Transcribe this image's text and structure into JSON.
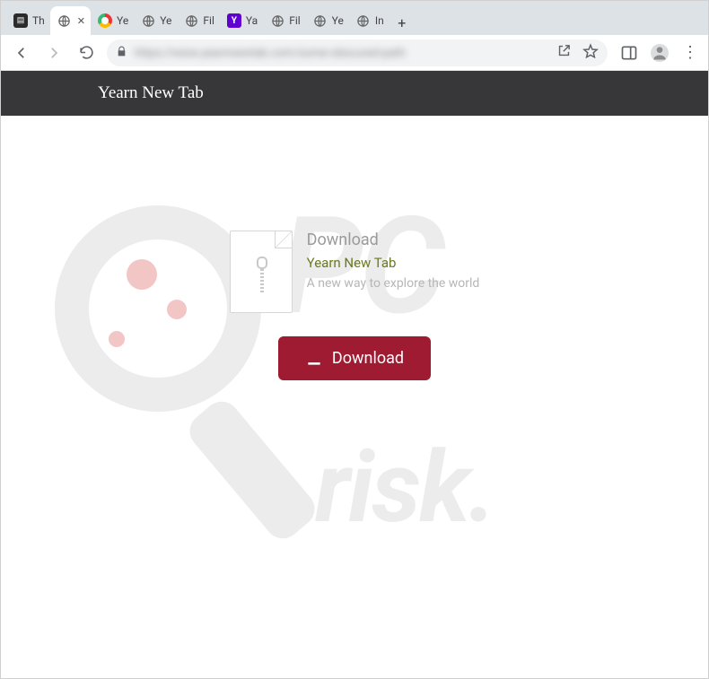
{
  "window": {
    "controls": {
      "min": "—",
      "max": "□",
      "close": "✕"
    }
  },
  "tabs": [
    {
      "label": "Th",
      "icon": "dark"
    },
    {
      "label": "",
      "icon": "globe",
      "loading": true
    },
    {
      "label": "Ye",
      "icon": "chrome"
    },
    {
      "label": "Ye",
      "icon": "globe"
    },
    {
      "label": "Fil",
      "icon": "globe"
    },
    {
      "label": "Ya",
      "icon": "yahoo"
    },
    {
      "label": "Fil",
      "icon": "globe"
    },
    {
      "label": "Ye",
      "icon": "globe"
    },
    {
      "label": "In",
      "icon": "globe"
    }
  ],
  "toolbar": {
    "url_obscured": "https://www.yearnnewtab.com/some-obscured-path",
    "share": "↗",
    "star": "☆",
    "panel": "▭",
    "menu": "⋮"
  },
  "page": {
    "header_title": "Yearn New Tab",
    "card": {
      "heading": "Download",
      "name": "Yearn New Tab",
      "subtitle": "A new way to explore the world"
    },
    "button_label": "Download"
  },
  "colors": {
    "header_bg": "#37373a",
    "accent_green": "#6a7a1f",
    "button_bg": "#9e1b32"
  }
}
